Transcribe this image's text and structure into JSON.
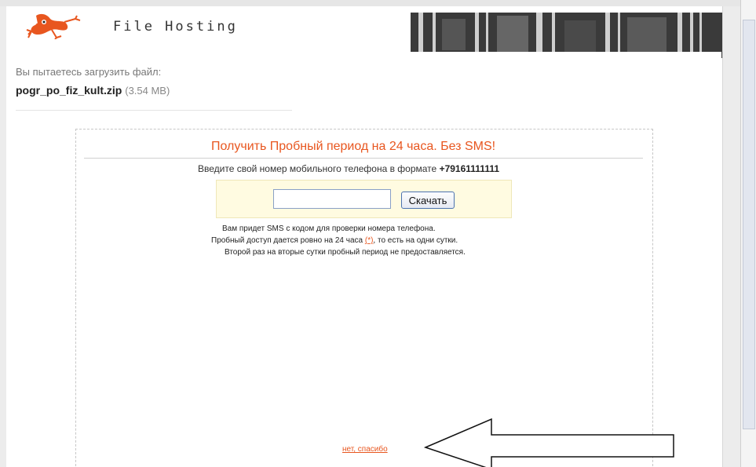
{
  "header": {
    "site_name": "File Hosting",
    "logo_icon": "gecko-logo-icon",
    "banner_image": "server-rack-banner"
  },
  "upload": {
    "hint": "Вы пытаетесь загрузить файл:",
    "file_name": "pogr_po_fiz_kult.zip",
    "file_size": "(3.54 MB)"
  },
  "offer": {
    "title": "Получить Пробный период на 24 часа. Без SMS!",
    "instruction_prefix": "Введите свой номер мобильного телефона в формате",
    "instruction_format": "+79161111111",
    "phone_value": "",
    "download_label": "Скачать",
    "note_line1": "Вам придет SMS с кодом для проверки номера телефона.",
    "note_line2_before": "Пробный доступ дается ровно на 24 часа",
    "note_marker": "(*)",
    "note_line2_after": ", то есть на одни сутки.",
    "note_line3": "Второй раз на вторые сутки пробный период не предоставляется.",
    "decline_link": "нет, спасибо"
  },
  "annotation": {
    "arrow_icon": "left-arrow-outline"
  },
  "colors": {
    "accent": "#e8561f",
    "panel_bg": "#fffbe1",
    "button_border": "#4b72b0"
  }
}
